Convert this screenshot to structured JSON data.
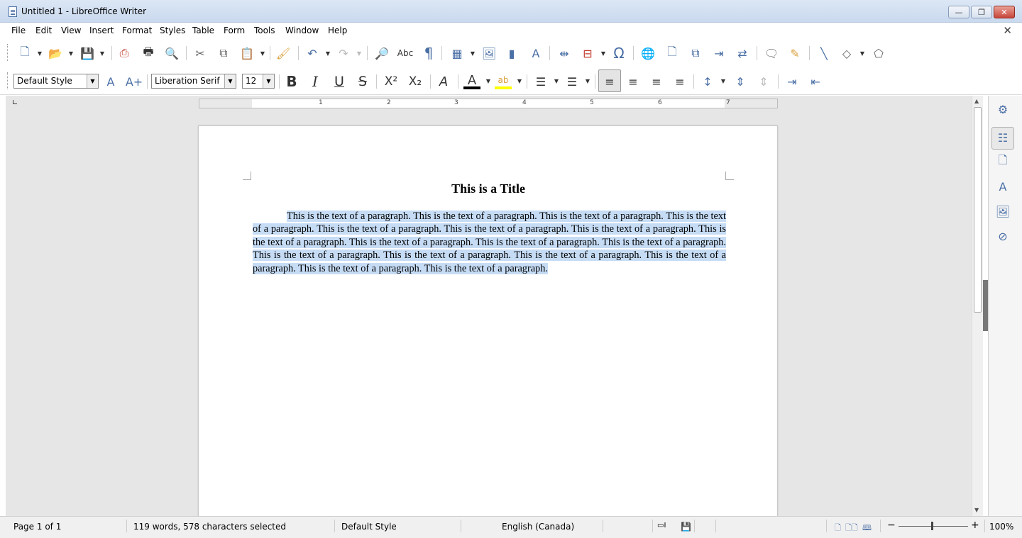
{
  "window": {
    "title": "Untitled 1 - LibreOffice Writer",
    "minimize": "—",
    "maximize": "❐",
    "close": "✕"
  },
  "menu": [
    "File",
    "Edit",
    "View",
    "Insert",
    "Format",
    "Styles",
    "Table",
    "Form",
    "Tools",
    "Window",
    "Help"
  ],
  "formatting": {
    "paragraph_style": "Default Style",
    "font_name": "Liberation Serif",
    "font_size": "12"
  },
  "ruler": {
    "numbers": [
      "1",
      "2",
      "3",
      "4",
      "5",
      "6",
      "7"
    ]
  },
  "document": {
    "title": "This is a Title",
    "paragraph": "This is the text of a paragraph.  This is the text of a paragraph.  This is the text of a paragraph.  This is the text of a paragraph.  This is the text of a paragraph.  This is the text of a paragraph.  This is the text of a paragraph.  This is the text of a paragraph.  This is the text of a paragraph.  This is the text of a paragraph.  This is the text of a paragraph.  This is the text of a paragraph.  This is the text of a paragraph.  This is the text of a paragraph.  This is the text of a paragraph.  This is the text of a paragraph.  This is the text of a paragraph."
  },
  "statusbar": {
    "page": "Page 1 of 1",
    "word_count": "119 words, 578 characters selected",
    "page_style": "Default Style",
    "language": "English (Canada)",
    "zoom": "100%"
  },
  "colors": {
    "selection": "#c6dcf5",
    "font_color_bar": "#000000",
    "highlight_bar": "#ffff00",
    "accent": "#4a6fa5"
  }
}
